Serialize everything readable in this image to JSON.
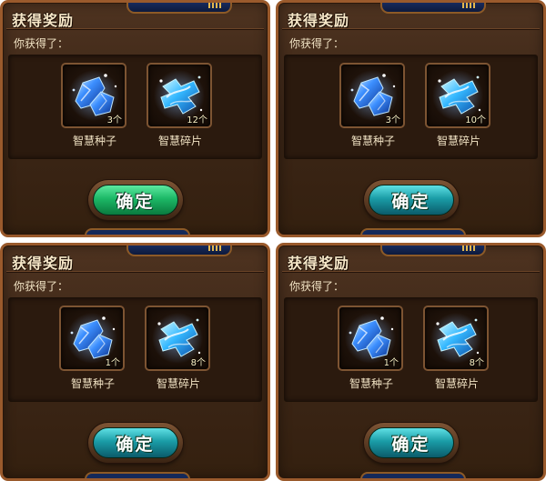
{
  "panels": [
    {
      "title": "获得奖励",
      "subtitle": "你获得了：",
      "items": [
        {
          "name": "智慧种子",
          "count": "3个",
          "icon": "wisdom-seed-icon"
        },
        {
          "name": "智慧碎片",
          "count": "12个",
          "icon": "wisdom-fragment-icon"
        }
      ],
      "confirm_label": "确定",
      "button_color": "#1cb866"
    },
    {
      "title": "获得奖励",
      "subtitle": "你获得了：",
      "items": [
        {
          "name": "智慧种子",
          "count": "3个",
          "icon": "wisdom-seed-icon"
        },
        {
          "name": "智慧碎片",
          "count": "10个",
          "icon": "wisdom-fragment-icon"
        }
      ],
      "confirm_label": "确定",
      "button_color": "#1a9ca6"
    },
    {
      "title": "获得奖励",
      "subtitle": "你获得了：",
      "items": [
        {
          "name": "智慧种子",
          "count": "1个",
          "icon": "wisdom-seed-icon"
        },
        {
          "name": "智慧碎片",
          "count": "8个",
          "icon": "wisdom-fragment-icon"
        }
      ],
      "confirm_label": "确定",
      "button_color": "#1a9ca6"
    },
    {
      "title": "获得奖励",
      "subtitle": "你获得了：",
      "items": [
        {
          "name": "智慧种子",
          "count": "1个",
          "icon": "wisdom-seed-icon"
        },
        {
          "name": "智慧碎片",
          "count": "8个",
          "icon": "wisdom-fragment-icon"
        }
      ],
      "confirm_label": "确定",
      "button_color": "#1a9ca6"
    }
  ]
}
